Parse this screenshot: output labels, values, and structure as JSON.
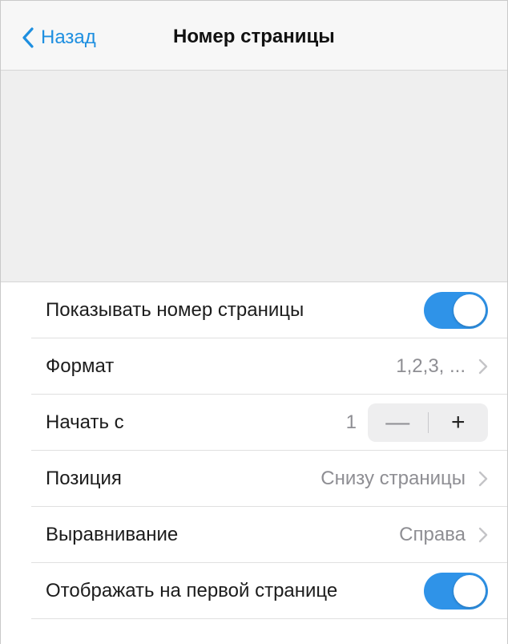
{
  "navbar": {
    "back_label": "Назад",
    "title": "Номер страницы"
  },
  "settings": {
    "show_page_number": {
      "label": "Показывать номер страницы",
      "enabled": true
    },
    "format": {
      "label": "Формат",
      "value": "1,2,3, ..."
    },
    "start_at": {
      "label": "Начать с",
      "value": "1",
      "minus": "—",
      "plus": "+"
    },
    "position": {
      "label": "Позиция",
      "value": "Снизу страницы"
    },
    "alignment": {
      "label": "Выравнивание",
      "value": "Справа"
    },
    "show_on_first_page": {
      "label": "Отображать на первой странице",
      "enabled": true
    }
  },
  "colors": {
    "accent": "#1e8fe0",
    "toggle_on": "#2f93e8",
    "secondary_text": "#8e8e93"
  }
}
